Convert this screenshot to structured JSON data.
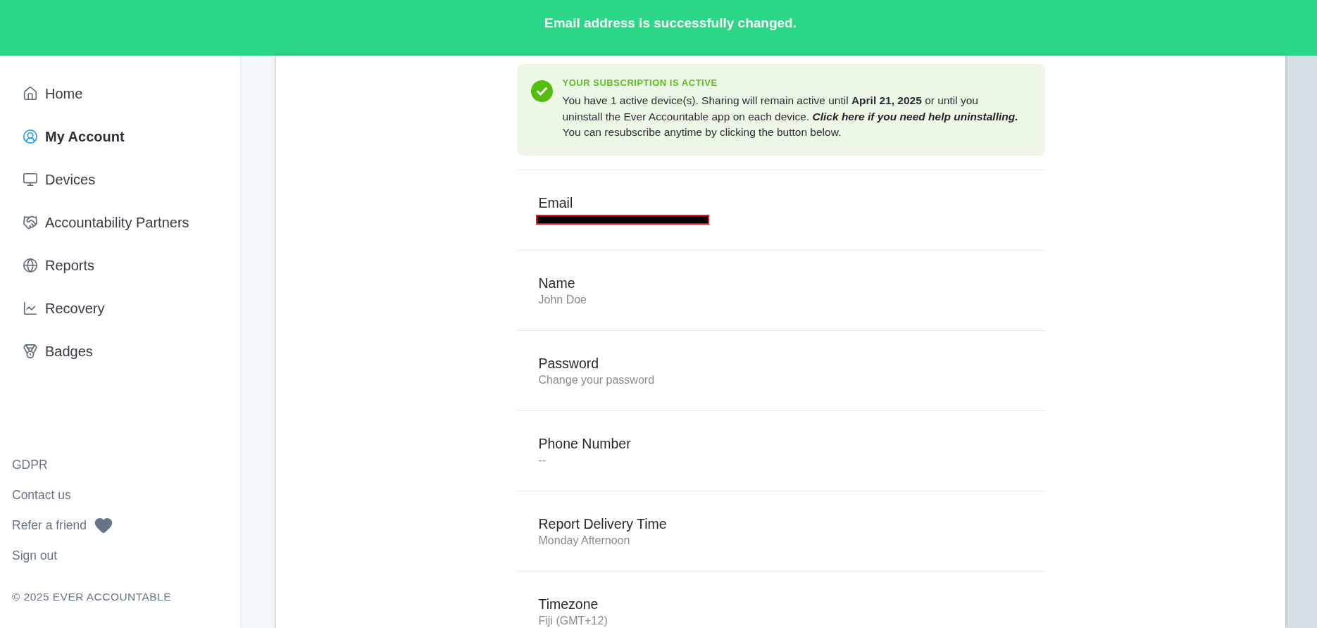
{
  "banner": {
    "message": "Email address is successfully changed."
  },
  "sidebar": {
    "nav": [
      {
        "label": "Home",
        "selected": false
      },
      {
        "label": "My Account",
        "selected": true
      },
      {
        "label": "Devices",
        "selected": false
      },
      {
        "label": "Accountability Partners",
        "selected": false
      },
      {
        "label": "Reports",
        "selected": false
      },
      {
        "label": "Recovery",
        "selected": false
      },
      {
        "label": "Badges",
        "selected": false
      }
    ],
    "footer_links": [
      {
        "label": "GDPR",
        "kind": "plain"
      },
      {
        "label": "Contact us",
        "kind": "plain"
      },
      {
        "label": "Refer a friend",
        "kind": "heart"
      },
      {
        "label": "Sign out",
        "kind": "plain"
      }
    ],
    "copyright": "© 2025 EVER ACCOUNTABLE"
  },
  "subscription": {
    "title": "YOUR SUBSCRIPTION IS ACTIVE",
    "message": "You have 1 active device(s). Sharing will remain active until **April 21, 2025** or until you uninstall the Ever Accountable app on each device.",
    "help_link": "Click here if you need help uninstalling.",
    "note": "You can resubscribe anytime by clicking the button below."
  },
  "settings": [
    {
      "label": "Email",
      "kind": "redacted"
    },
    {
      "label": "Name",
      "kind": "text",
      "value": "John Doe"
    },
    {
      "label": "Password",
      "kind": "text",
      "value": "Change your password"
    },
    {
      "label": "Phone Number",
      "kind": "text",
      "value": "--"
    },
    {
      "label": "Report Delivery Time",
      "kind": "text",
      "value": "Monday Afternoon"
    },
    {
      "label": "Timezone",
      "kind": "text",
      "value": "Fiji (GMT+12)"
    }
  ]
}
